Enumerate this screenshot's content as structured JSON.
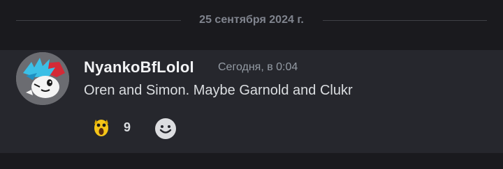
{
  "divider": {
    "date": "25 сентября 2024 г."
  },
  "message": {
    "author": "NyankoBfLolol",
    "timestamp": "Сегодня, в 0:04",
    "content": "Oren and Simon. Maybe Garnold and Clukr",
    "avatar_icon": "avatar-icon",
    "reactions": [
      {
        "emoji_icon": "screaming-face-emoji-icon",
        "count": "9"
      }
    ],
    "add_reaction_icon": "smiley-face-icon"
  },
  "colors": {
    "background": "#1a1a1e",
    "message_highlight": "#26272d",
    "username": "#f2f3f5",
    "timestamp": "#949ba4",
    "text": "#dbdee1",
    "divider": "#3f4147"
  }
}
